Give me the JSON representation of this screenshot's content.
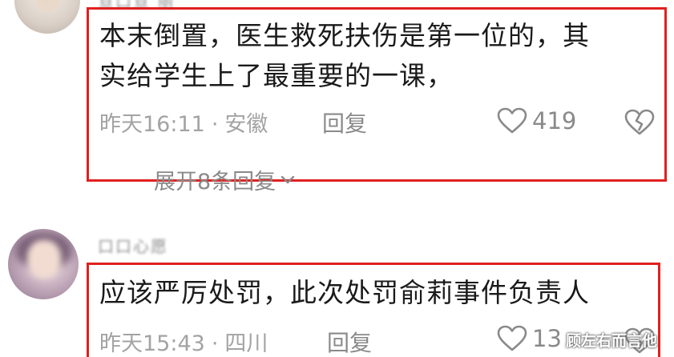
{
  "comments": [
    {
      "username": "亘口亘 丽",
      "text": "本末倒置，医生救死扶伤是第一位的，其\n实给学生上了最重要的一课，",
      "date": "昨天16:11",
      "separator": "·",
      "location": "安徽",
      "reply_label": "回复",
      "like_count": "419",
      "expand_label": "展开8条回复"
    },
    {
      "username": "口口心愿",
      "text": "应该严厉处罚，此次处罚俞莉事件负责人",
      "date": "昨天15:43",
      "separator": "·",
      "location": "四川",
      "reply_label": "回复",
      "like_count": "13"
    }
  ],
  "watermark": "顾左右而言他",
  "icons": {
    "like": "heart-outline-icon",
    "dislike": "broken-heart-icon",
    "expand": "chevron-down-icon"
  },
  "colors": {
    "highlight_border": "#e0201f",
    "text": "#1a1a1a",
    "meta": "#a3a3a3"
  }
}
